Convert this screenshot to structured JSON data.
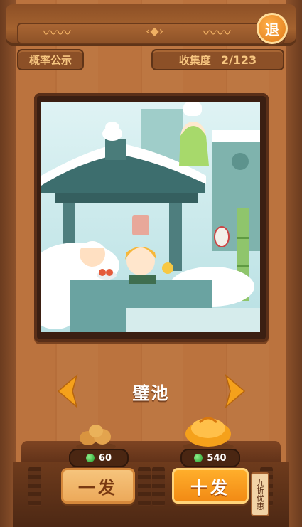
{
  "header": {
    "exit_label": "退"
  },
  "info": {
    "probability_label": "概率公示",
    "collection_label": "收集度",
    "collection_value": "2/123"
  },
  "card": {
    "name": "璧池"
  },
  "draw": {
    "single": {
      "label": "一发",
      "cost": "60"
    },
    "ten": {
      "label": "十发",
      "cost": "540"
    },
    "discount_label": "九折优惠"
  },
  "colors": {
    "accent_orange": "#f28a14",
    "wood": "#b56d38",
    "gem_green": "#1e9a2a"
  }
}
